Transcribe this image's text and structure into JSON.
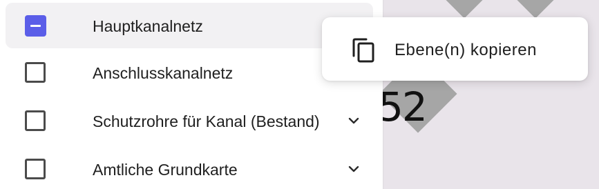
{
  "layer_panel": {
    "items": [
      {
        "label": "Hauptkanalnetz",
        "checkbox_state": "indeterminate",
        "has_chevron": false
      },
      {
        "label": "Anschlusskanalnetz",
        "checkbox_state": "unchecked",
        "has_chevron": false
      },
      {
        "label": "Schutzrohre für Kanal (Bestand)",
        "checkbox_state": "unchecked",
        "has_chevron": true
      },
      {
        "label": "Amtliche Grundkarte",
        "checkbox_state": "unchecked",
        "has_chevron": true
      }
    ]
  },
  "context_menu": {
    "items": [
      {
        "label": "Ebene(n) kopieren",
        "icon": "copy-icon"
      }
    ]
  },
  "map": {
    "label": "52"
  },
  "colors": {
    "accent": "#5b5ee8",
    "active_row_bg": "#f2f1f3",
    "map_bg": "#e9e4ea",
    "map_feature": "#a6a6a6"
  }
}
